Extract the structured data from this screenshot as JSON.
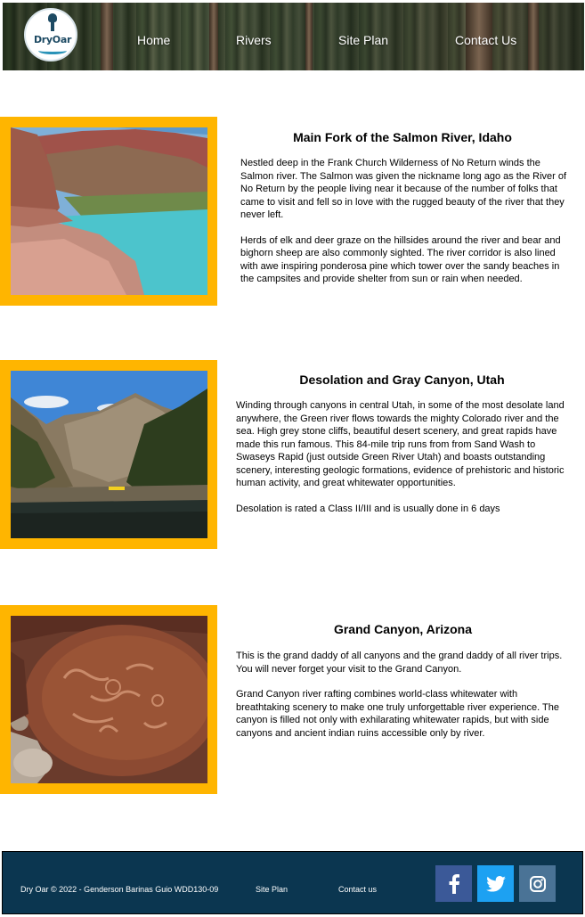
{
  "header": {
    "logo_text": "DryOar",
    "nav": [
      "Home",
      "Rivers",
      "Site Plan",
      "Contact Us"
    ]
  },
  "rivers": [
    {
      "title": "Main Fork of the Salmon River, Idaho",
      "paragraphs": [
        "Nestled deep in the Frank Church Wilderness of No Return winds the Salmon river. The Salmon was given the nickname long ago as the River of No Return by the people living near it because of the number of folks that came to visit and fell so in love with the rugged beauty of the river that they never left.",
        "Herds of elk and deer graze on the hillsides around the river and bear and bighorn sheep are also commonly sighted. The river corridor is also lined with awe inspiring ponderosa pine which tower over the sandy beaches in the campsites and provide shelter from sun or rain when needed."
      ]
    },
    {
      "title": "Desolation and Gray Canyon, Utah",
      "paragraphs": [
        "Winding through canyons in central Utah, in some of the most desolate land anywhere, the Green river flows towards the mighty Colorado river and the sea. High grey stone cliffs, beautiful desert scenery, and great rapids have made this run famous. This 84-mile trip runs from from Sand Wash to Swaseys Rapid (just outside Green River Utah) and boasts outstanding scenery, interesting geologic formations, evidence of prehistoric and historic human activity, and great whitewater opportunities.",
        "Desolation is rated a Class II/III and is usually done in 6 days"
      ]
    },
    {
      "title": "Grand Canyon, Arizona",
      "paragraphs": [
        "This is the grand daddy of all canyons and the grand daddy of all river trips. You will never forget your visit to the Grand Canyon.",
        "Grand Canyon river rafting combines world-class whitewater with breathtaking scenery to make one truly unforgettable river experience. The canyon is filled not only with exhilarating whitewater rapids, but with side canyons and ancient indian ruins accessible only by river."
      ]
    }
  ],
  "footer": {
    "copyright": "Dry Oar © 2022 - Genderson Barinas Guio WDD130-09",
    "site_plan": "Site Plan",
    "contact": "Contact us",
    "social": [
      {
        "icon": "facebook-icon",
        "color": "#3b5998"
      },
      {
        "icon": "twitter-icon",
        "color": "#1da1f2"
      },
      {
        "icon": "instagram-icon",
        "color": "#4a7396"
      }
    ]
  },
  "colors": {
    "frame": "#ffb500",
    "footer_bg": "#0b3650"
  }
}
